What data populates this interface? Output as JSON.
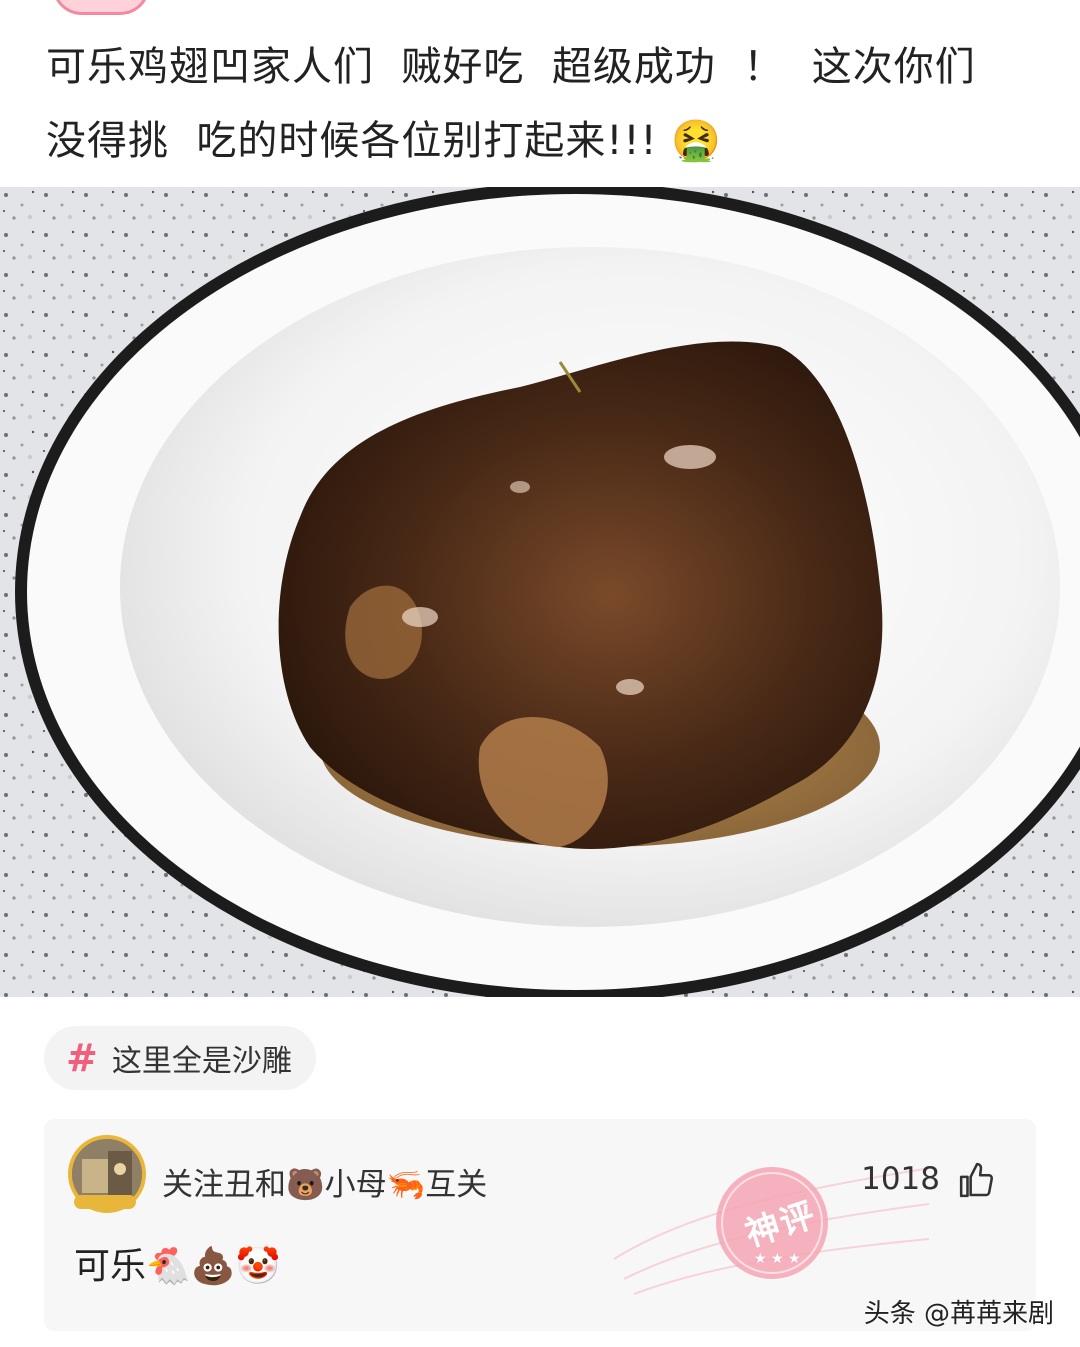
{
  "post": {
    "text": "可乐鸡翅凹家人们  贼好吃  超级成功  ！  这次你们\n没得挑  吃的时候各位别打起来!!! 🤮"
  },
  "photo": {
    "subject": "braised-cola-chicken-bowl"
  },
  "topic": {
    "label": "这里全是沙雕",
    "icon": "hash-icon",
    "hash_symbol": "#",
    "color": "#f0607e"
  },
  "comment": {
    "username": "关注丑和🐻小母🦐互关",
    "likes": "1018",
    "text": "可乐🐔💩🤡",
    "badge": "神评",
    "like_icon": "thumbs-up-icon"
  },
  "watermark": {
    "text": "头条 @苒苒来剧"
  },
  "colors": {
    "accent": "#f0607e",
    "card_bg": "#f7f7f7",
    "chip_bg": "#f3f3f3",
    "stamp": "#f4a6b4"
  }
}
